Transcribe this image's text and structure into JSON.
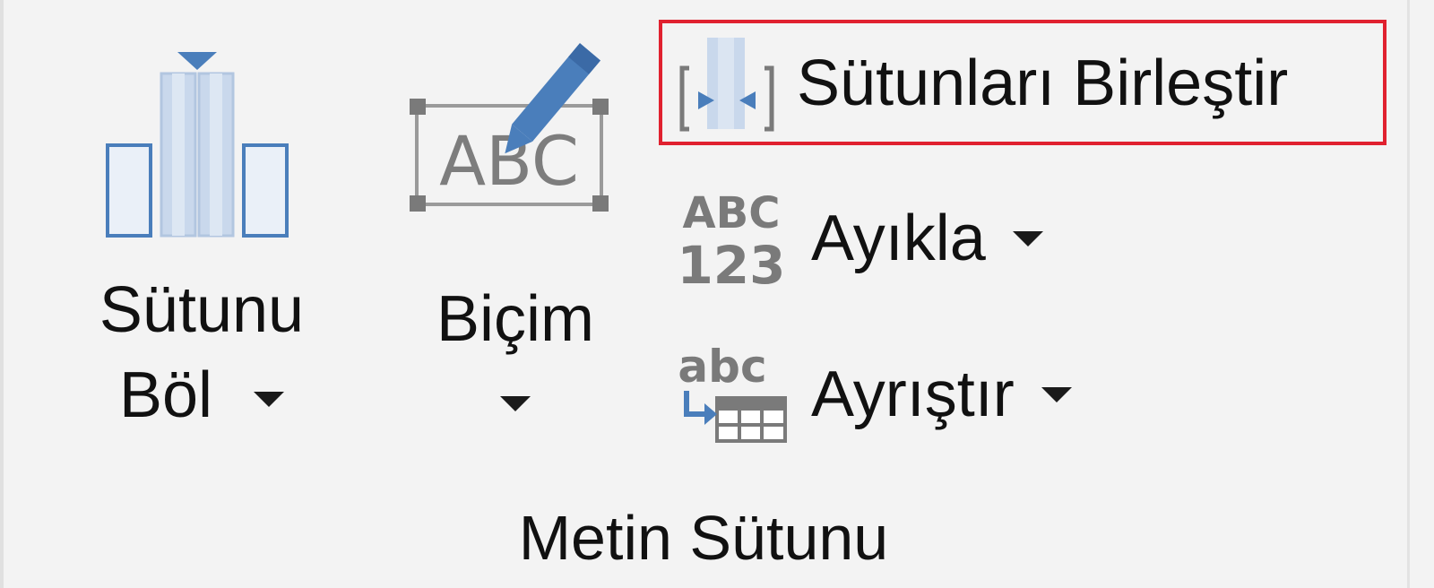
{
  "ribbon_group": {
    "label": "Metin Sütunu",
    "buttons": {
      "split_column": {
        "line1": "Sütunu",
        "line2": "Böl",
        "icon": "split-column-icon",
        "has_dropdown": true
      },
      "format": {
        "label": "Biçim",
        "icon": "abc-pencil-icon",
        "has_dropdown": true
      },
      "merge_columns": {
        "label": "Sütunları Birleştir",
        "icon": "merge-columns-icon",
        "highlighted": true
      },
      "extract": {
        "label": "Ayıkla",
        "icon": "abc-123-icon",
        "icon_text_top": "ABC",
        "icon_text_bottom": "123",
        "has_dropdown": true
      },
      "parse": {
        "label": "Ayrıştır",
        "icon": "abc-to-table-icon",
        "icon_text": "abc",
        "has_dropdown": true
      }
    }
  },
  "colors": {
    "highlight_border": "#e0212f",
    "icon_blue": "#4a7ebb",
    "icon_light_blue": "#c9d8ec",
    "icon_gray": "#7a7a7a",
    "background": "#f3f3f3"
  }
}
